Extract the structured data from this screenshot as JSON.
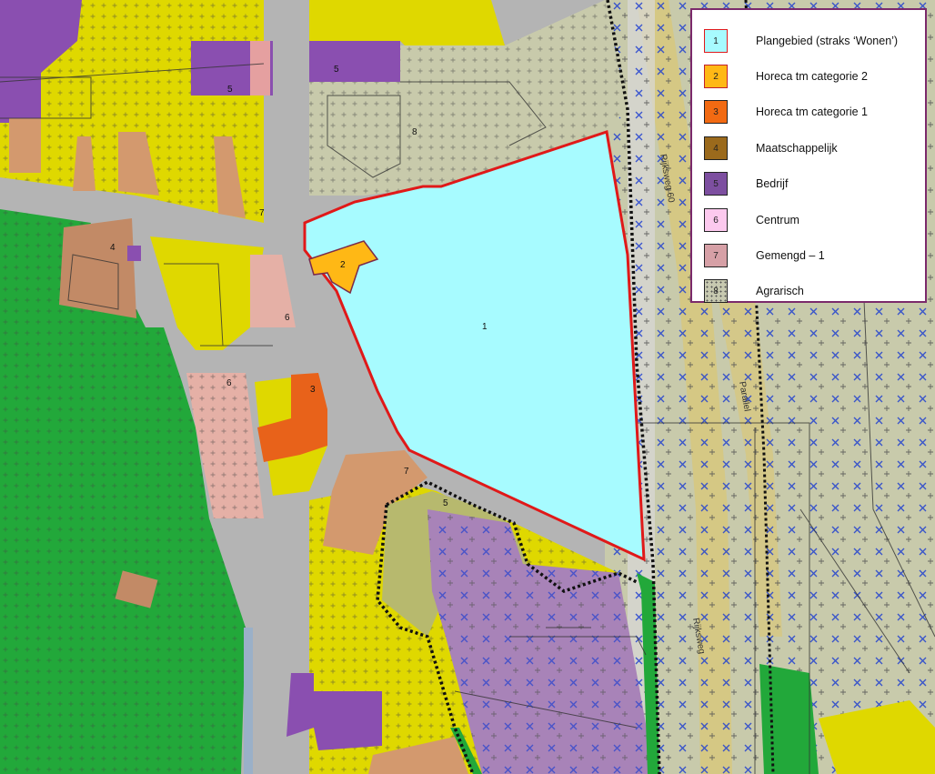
{
  "map": {
    "plan_area_label": "1",
    "zone_numbers": [
      {
        "id": "z-1",
        "label": "1"
      },
      {
        "id": "z-2",
        "label": "2"
      },
      {
        "id": "z-3",
        "label": "3"
      },
      {
        "id": "z-4",
        "label": "4"
      },
      {
        "id": "z-5a",
        "label": "5"
      },
      {
        "id": "z-5b",
        "label": "5"
      },
      {
        "id": "z-5c",
        "label": "5"
      },
      {
        "id": "z-6a",
        "label": "6"
      },
      {
        "id": "z-6b",
        "label": "6"
      },
      {
        "id": "z-7a",
        "label": "7"
      },
      {
        "id": "z-7b",
        "label": "7"
      },
      {
        "id": "z-8",
        "label": "8"
      }
    ],
    "road_labels": [
      "Rijksweg 60",
      "Parallel",
      "Rijksweg"
    ]
  },
  "legend": {
    "items": [
      {
        "number": "1",
        "label": "Plangebied (straks ‘Wonen’)",
        "color": "#a7fbff",
        "border": "#e0191c"
      },
      {
        "number": "2",
        "label": "Horeca tm categorie 2",
        "color": "#ffb815",
        "border": "#c0202e"
      },
      {
        "number": "3",
        "label": "Horeca tm categorie 1",
        "color": "#f26a12",
        "border": "#222222"
      },
      {
        "number": "4",
        "label": "Maatschappelijk",
        "color": "#9b6a1c",
        "border": "#222222"
      },
      {
        "number": "5",
        "label": "Bedrijf",
        "color": "#7d4fa0",
        "border": "#222222"
      },
      {
        "number": "6",
        "label": "Centrum",
        "color": "#fcc9ee",
        "border": "#222222"
      },
      {
        "number": "7",
        "label": "Gemengd – 1",
        "color": "#d6a0a6",
        "border": "#222222"
      },
      {
        "number": "8",
        "label": "Agrarisch",
        "color": "#c7c9b0",
        "border": "#222222"
      }
    ]
  },
  "colors": {
    "wonen": "#dfd800",
    "groen": "#22a83a",
    "verkeer": "#b4b4b4",
    "agrarisch": "#c8caab",
    "bedrijf": "#a883b8",
    "gemengd": "#e5b0a6",
    "maatschappelijk": "#c28a66",
    "plangebied": "#a7fbff",
    "plangebied_border": "#e01919",
    "spoor": "#d8c77a"
  }
}
